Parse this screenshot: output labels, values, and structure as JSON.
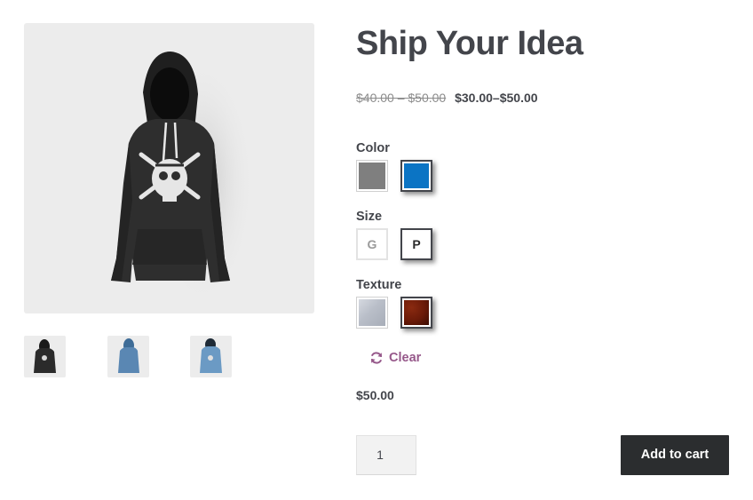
{
  "product": {
    "title": "Ship Your Idea",
    "price_range_old": "$40.00 – $50.00",
    "price_range_new": "$30.00–$50.00",
    "variation_price": "$50.00"
  },
  "images": {
    "main": {
      "alt": "hoodie-with-skull-graphic",
      "color": "#2e2e2e"
    },
    "thumbnails": [
      {
        "color": "#2b2b2b"
      },
      {
        "color": "#5a87b3"
      },
      {
        "color": "#6b9ac4"
      }
    ]
  },
  "attributes": {
    "color": {
      "label": "Color",
      "options": [
        {
          "name": "gray",
          "value": "#7f7f7f",
          "selected": false
        },
        {
          "name": "blue",
          "value": "#0b74c4",
          "selected": true
        }
      ]
    },
    "size": {
      "label": "Size",
      "options": [
        {
          "label": "G",
          "selected": false
        },
        {
          "label": "P",
          "selected": true
        }
      ]
    },
    "texture": {
      "label": "Texture",
      "options": [
        {
          "name": "silver",
          "value": "#b9bec8",
          "selected": false
        },
        {
          "name": "rust",
          "value": "#6a1a08",
          "selected": true
        }
      ]
    }
  },
  "actions": {
    "clear_label": "Clear",
    "quantity_value": "1",
    "add_to_cart_label": "Add to cart"
  },
  "colors": {
    "accent": "#96588a",
    "button_bg": "#2b2d2f",
    "text": "#43454b"
  }
}
